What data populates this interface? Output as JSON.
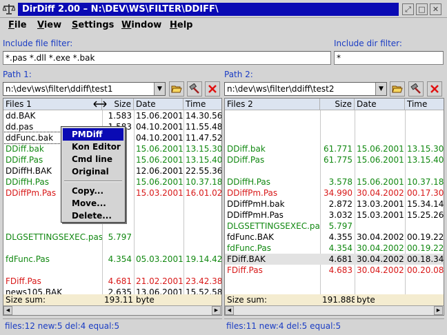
{
  "window": {
    "title": "DirDiff 2.00 – N:\\DEV\\WS\\FILTER\\DDIFF\\"
  },
  "menu": [
    {
      "label": "File",
      "ul": "F",
      "rest": "ile"
    },
    {
      "label": "View",
      "ul": "V",
      "rest": "iew"
    },
    {
      "label": "Settings",
      "ul": "S",
      "rest": "ettings"
    },
    {
      "label": "Window",
      "ul": "W",
      "rest": "indow"
    },
    {
      "label": "Help",
      "ul": "H",
      "rest": "elp"
    }
  ],
  "filters": {
    "file_label": "Include file filter:",
    "file_value": "*.pas *.dll *.exe *.bak",
    "dir_label": "Include dir filter:",
    "dir_value": "*"
  },
  "colors": {
    "green": "#118811",
    "red": "#d81818",
    "black": "#000000"
  },
  "panel1": {
    "label": "Path 1:",
    "path": "n:\\dev\\ws\\filter\\ddiff\\test1",
    "headers": [
      "Files 1",
      "Size",
      "Date",
      "Time"
    ],
    "rows": [
      {
        "name": "dd.BAK",
        "size": "1.583",
        "date": "15.06.2001",
        "time": "14.30.56",
        "color": "black"
      },
      {
        "name": "dd.pas",
        "size": "1.583",
        "date": "04.10.2001",
        "time": "11.55.48",
        "color": "black"
      },
      {
        "name": "ddFunc.bak",
        "size": "",
        "date": "04.10.2001",
        "time": "11.47.52",
        "color": "black",
        "dotted": true
      },
      {
        "name": "DDiff.bak",
        "size": "",
        "date": "15.06.2001",
        "time": "13.15.30",
        "color": "green"
      },
      {
        "name": "DDiff.Pas",
        "size": "",
        "date": "15.06.2001",
        "time": "13.15.40",
        "color": "green"
      },
      {
        "name": "DDiffH.BAK",
        "size": "",
        "date": "12.06.2001",
        "time": "22.55.36",
        "color": "black"
      },
      {
        "name": "DDiffH.Pas",
        "size": "",
        "date": "15.06.2001",
        "time": "10.37.18",
        "color": "green"
      },
      {
        "name": "DDiffPm.Pas",
        "size": "",
        "date": "15.03.2001",
        "time": "16.01.02",
        "color": "red"
      },
      {
        "name": "",
        "size": "",
        "date": "",
        "time": "",
        "color": "black"
      },
      {
        "name": "",
        "size": "",
        "date": "",
        "time": "",
        "color": "black"
      },
      {
        "name": "",
        "size": "",
        "date": "",
        "time": "",
        "color": "black"
      },
      {
        "name": "DLGSETTINGSEXEC.pas",
        "size": "5.797",
        "date": "",
        "time": "",
        "color": "green"
      },
      {
        "name": "",
        "size": "",
        "date": "",
        "time": "",
        "color": "black"
      },
      {
        "name": "fdFunc.Pas",
        "size": "4.354",
        "date": "05.03.2001",
        "time": "19.14.42",
        "color": "green"
      },
      {
        "name": "",
        "size": "",
        "date": "",
        "time": "",
        "color": "black"
      },
      {
        "name": "FDiff.Pas",
        "size": "4.681",
        "date": "21.02.2001",
        "time": "23.42.38",
        "color": "red"
      },
      {
        "name": "news105.BAK",
        "size": "2.635",
        "date": "13.06.2001",
        "time": "15.52.58",
        "color": "black"
      }
    ],
    "sum_label": "Size sum:",
    "sum_value": "193.112",
    "sum_unit": "byte",
    "status": "files:12 new:5 del:4 equal:5"
  },
  "panel2": {
    "label": "Path 2:",
    "path": "n:\\dev\\ws\\filter\\ddiff\\test2",
    "headers": [
      "Files 2",
      "Size",
      "Date",
      "Time"
    ],
    "rows": [
      {
        "name": "",
        "size": "",
        "date": "",
        "time": "",
        "color": "black"
      },
      {
        "name": "",
        "size": "",
        "date": "",
        "time": "",
        "color": "black"
      },
      {
        "name": "",
        "size": "",
        "date": "",
        "time": "",
        "color": "black"
      },
      {
        "name": "DDiff.bak",
        "size": "61.771",
        "date": "15.06.2001",
        "time": "13.15.30",
        "color": "green"
      },
      {
        "name": "DDiff.Pas",
        "size": "61.775",
        "date": "15.06.2001",
        "time": "13.15.40",
        "color": "green"
      },
      {
        "name": "",
        "size": "",
        "date": "",
        "time": "",
        "color": "black"
      },
      {
        "name": "DDiffH.Pas",
        "size": "3.578",
        "date": "15.06.2001",
        "time": "10.37.18",
        "color": "green"
      },
      {
        "name": "DDiffPm.Pas",
        "size": "34.990",
        "date": "30.04.2002",
        "time": "00.17.30",
        "color": "red"
      },
      {
        "name": "DDiffPmH.bak",
        "size": "2.872",
        "date": "13.03.2001",
        "time": "15.34.14",
        "color": "black"
      },
      {
        "name": "DDiffPmH.Pas",
        "size": "3.032",
        "date": "15.03.2001",
        "time": "15.25.26",
        "color": "black"
      },
      {
        "name": "DLGSETTINGSEXEC.pas",
        "size": "5.797",
        "date": "",
        "time": "",
        "color": "green"
      },
      {
        "name": "fdFunc.BAK",
        "size": "4.355",
        "date": "30.04.2002",
        "time": "00.19.22",
        "color": "black"
      },
      {
        "name": "fdFunc.Pas",
        "size": "4.354",
        "date": "30.04.2002",
        "time": "00.19.22",
        "color": "green"
      },
      {
        "name": "FDiff.BAK",
        "size": "4.681",
        "date": "30.04.2002",
        "time": "00.18.34",
        "color": "black",
        "highlight": true
      },
      {
        "name": "FDiff.Pas",
        "size": "4.683",
        "date": "30.04.2002",
        "time": "00.20.08",
        "color": "red"
      }
    ],
    "sum_label": "Size sum:",
    "sum_value": "191.888",
    "sum_unit": "byte",
    "status": "files:11 new:4 del:5 equal:5"
  },
  "context_menu": [
    {
      "label": "PMDiff",
      "selected": true
    },
    {
      "label": "Kon Editor"
    },
    {
      "label": "Cmd line"
    },
    {
      "label": "Original"
    },
    {
      "separator": true
    },
    {
      "label": "Copy..."
    },
    {
      "label": "Move..."
    },
    {
      "label": "Delete..."
    }
  ],
  "icons": {
    "app": "scales-icon",
    "open": "folder-open-icon",
    "edit": "hammer-icon",
    "close": "red-x-icon",
    "resize": "resize-arrow-icon"
  }
}
